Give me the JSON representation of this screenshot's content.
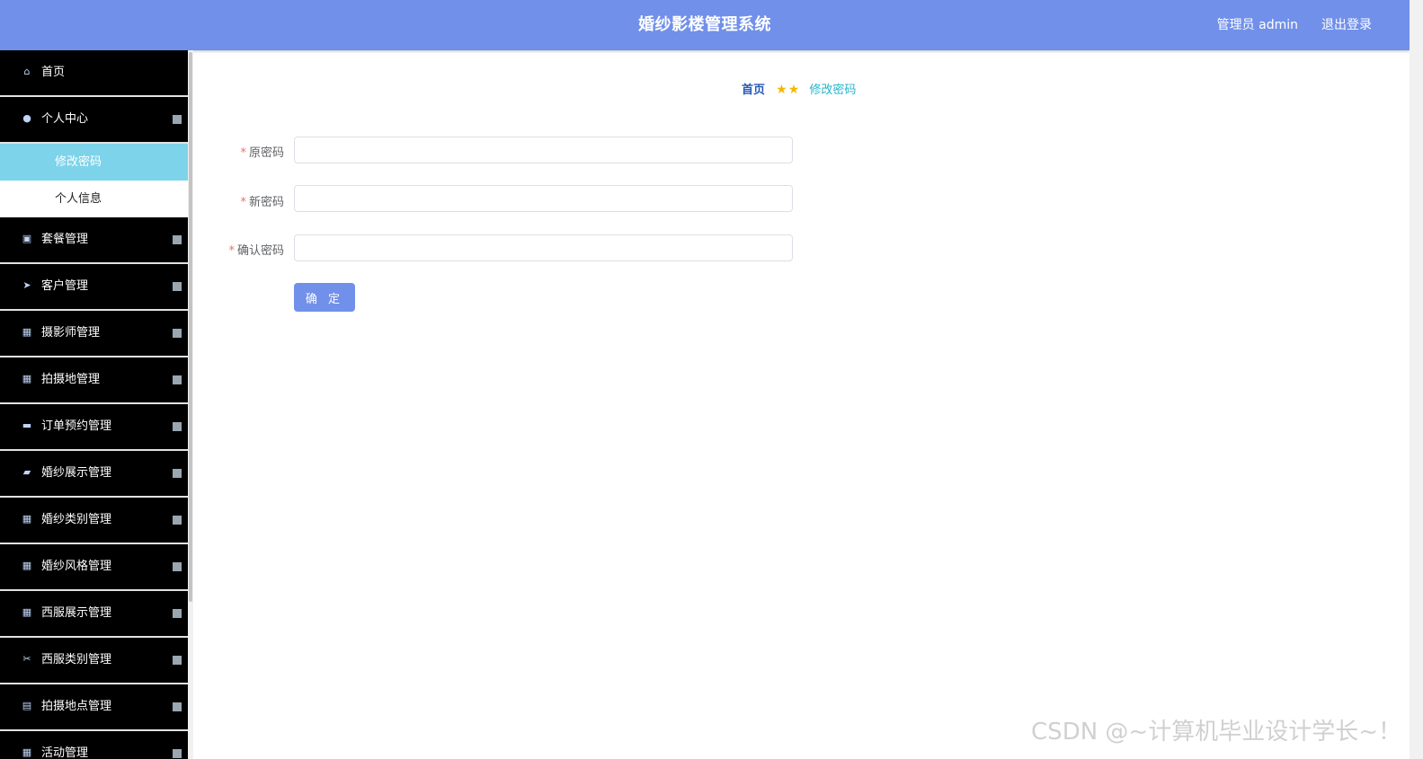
{
  "header": {
    "title": "婚纱影楼管理系统",
    "user_label": "管理员 admin",
    "logout_label": "退出登录",
    "bg_color": "#7190ea"
  },
  "sidebar": {
    "items": [
      {
        "icon": "home-icon",
        "label": "首页",
        "has_arrow": false
      },
      {
        "icon": "user-icon",
        "label": "个人中心",
        "has_arrow": true,
        "expanded": true,
        "children": [
          {
            "label": "修改密码",
            "active": true
          },
          {
            "label": "个人信息",
            "active": false
          }
        ]
      },
      {
        "icon": "chart-icon",
        "label": "套餐管理",
        "has_arrow": true
      },
      {
        "icon": "send-icon",
        "label": "客户管理",
        "has_arrow": true
      },
      {
        "icon": "grid-icon",
        "label": "摄影师管理",
        "has_arrow": true
      },
      {
        "icon": "grid-icon",
        "label": "拍摄地管理",
        "has_arrow": true
      },
      {
        "icon": "monitor-icon",
        "label": "订单预约管理",
        "has_arrow": true
      },
      {
        "icon": "wallet-icon",
        "label": "婚纱展示管理",
        "has_arrow": true
      },
      {
        "icon": "grid-icon",
        "label": "婚纱类别管理",
        "has_arrow": true
      },
      {
        "icon": "grid-icon",
        "label": "婚纱风格管理",
        "has_arrow": true
      },
      {
        "icon": "grid-icon",
        "label": "西服展示管理",
        "has_arrow": true
      },
      {
        "icon": "ticket-icon",
        "label": "西服类别管理",
        "has_arrow": true
      },
      {
        "icon": "chat-icon",
        "label": "拍摄地点管理",
        "has_arrow": true
      },
      {
        "icon": "grid-icon",
        "label": "活动管理",
        "has_arrow": true
      }
    ]
  },
  "breadcrumb": {
    "home": "首页",
    "current": "修改密码"
  },
  "form": {
    "fields": [
      {
        "label": "原密码",
        "required": true,
        "value": "",
        "placeholder": ""
      },
      {
        "label": "新密码",
        "required": true,
        "value": "",
        "placeholder": ""
      },
      {
        "label": "确认密码",
        "required": true,
        "value": "",
        "placeholder": ""
      }
    ],
    "submit_label": "确 定"
  },
  "watermark": "CSDN @~计算机毕业设计学长~！"
}
